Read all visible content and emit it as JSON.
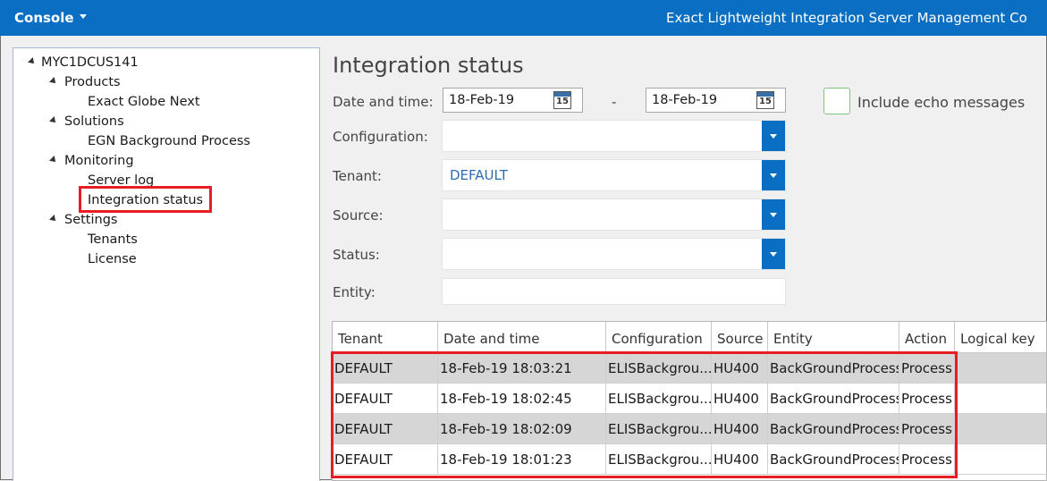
{
  "topbar": {
    "console_label": "Console",
    "app_title": "Exact Lightweight Integration Server Management Co"
  },
  "tree": {
    "root": "MYC1DCUS141",
    "products": "Products",
    "product_item": "Exact Globe Next",
    "solutions": "Solutions",
    "solution_item": "EGN Background Process",
    "monitoring": "Monitoring",
    "server_log": "Server log",
    "integration_status": "Integration status",
    "settings": "Settings",
    "tenants": "Tenants",
    "license": "License"
  },
  "main": {
    "title": "Integration status",
    "date_label": "Date and time:",
    "date_from": "18-Feb-19",
    "date_sep": "-",
    "date_to": "18-Feb-19",
    "calendar_day": "15",
    "echo_label": "Include echo messages",
    "configuration_label": "Configuration:",
    "tenant_label": "Tenant:",
    "tenant_value": "DEFAULT",
    "source_label": "Source:",
    "status_label": "Status:",
    "entity_label": "Entity:"
  },
  "grid": {
    "headers": [
      "Tenant",
      "Date and time",
      "Configuration",
      "Source",
      "Entity",
      "Action",
      "Logical key"
    ],
    "rows": [
      [
        "DEFAULT",
        "18-Feb-19 18:03:21",
        "ELISBackgrou...",
        "HU400",
        "BackGroundProcess",
        "Process",
        ""
      ],
      [
        "DEFAULT",
        "18-Feb-19 18:02:45",
        "ELISBackgrou...",
        "HU400",
        "BackGroundProcess",
        "Process",
        ""
      ],
      [
        "DEFAULT",
        "18-Feb-19 18:02:09",
        "ELISBackgrou...",
        "HU400",
        "BackGroundProcess",
        "Process",
        ""
      ],
      [
        "DEFAULT",
        "18-Feb-19 18:01:23",
        "ELISBackgrou...",
        "HU400",
        "BackGroundProcess",
        "Process",
        ""
      ]
    ]
  },
  "colors": {
    "accent": "#0a6fc2",
    "highlight": "#e81c24",
    "row_alt": "#d6d6d6"
  }
}
